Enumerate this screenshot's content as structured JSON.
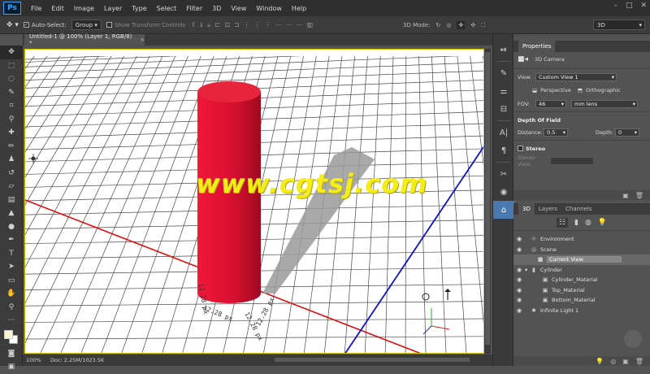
{
  "app": {
    "logo": "Ps"
  },
  "menu": [
    "File",
    "Edit",
    "Image",
    "Layer",
    "Type",
    "Select",
    "Filter",
    "3D",
    "View",
    "Window",
    "Help"
  ],
  "window_controls": [
    "–",
    "□",
    "✕"
  ],
  "options_bar": {
    "auto_select_label": "Auto-Select:",
    "auto_select_value": "Group",
    "show_transform_label": "Show Transform Controls",
    "mode_3d_label": "3D Mode:",
    "workspace_value": "3D"
  },
  "document": {
    "tab_title": "Untitled-1 @ 100% (Layer 1, RGB/8) *",
    "close_symbol": "×"
  },
  "canvas": {
    "watermark": "www.cgtsj.com",
    "dim_labels": [
      "12.28 px",
      "12.28 px",
      "12.28 px",
      "12.28 px"
    ],
    "colors": {
      "cylinder": "#e0142e",
      "x_axis": "#e01010",
      "z_axis": "#1010d0",
      "grid": "#4a4a4a",
      "selection_border": "#d8c800"
    }
  },
  "status": {
    "zoom": "100%",
    "doc": "Doc: 2.25M/1023.5K"
  },
  "properties": {
    "title": "Properties",
    "object": "3D Camera",
    "view_label": "View:",
    "view_value": "Custom View 1",
    "perspective_label": "Perspective",
    "orthographic_label": "Orthographic",
    "fov_label": "FOV:",
    "fov_value": "46",
    "fov_unit": "mm lens",
    "dof_title": "Depth Of Field",
    "distance_label": "Distance:",
    "distance_value": "0.5",
    "depth_label": "Depth:",
    "depth_value": "0",
    "stereo_label": "Stereo",
    "stereo_view_label": "Stereo View:"
  },
  "panel3d": {
    "tabs": [
      "3D",
      "Layers",
      "Channels"
    ],
    "tree": [
      {
        "label": "Environment",
        "icon": "☼",
        "indent": 0
      },
      {
        "label": "Scene",
        "icon": "◎",
        "indent": 0
      },
      {
        "label": "Current View",
        "icon": "■",
        "indent": 1,
        "selected": true
      },
      {
        "label": "Cylinder",
        "icon": "▮",
        "indent": 1
      },
      {
        "label": "Cylinder_Material",
        "icon": "▣",
        "indent": 2
      },
      {
        "label": "Top_Material",
        "icon": "▣",
        "indent": 2
      },
      {
        "label": "Bottom_Material",
        "icon": "▣",
        "indent": 2
      },
      {
        "label": "Infinite Light 1",
        "icon": "✸",
        "indent": 0
      }
    ]
  }
}
